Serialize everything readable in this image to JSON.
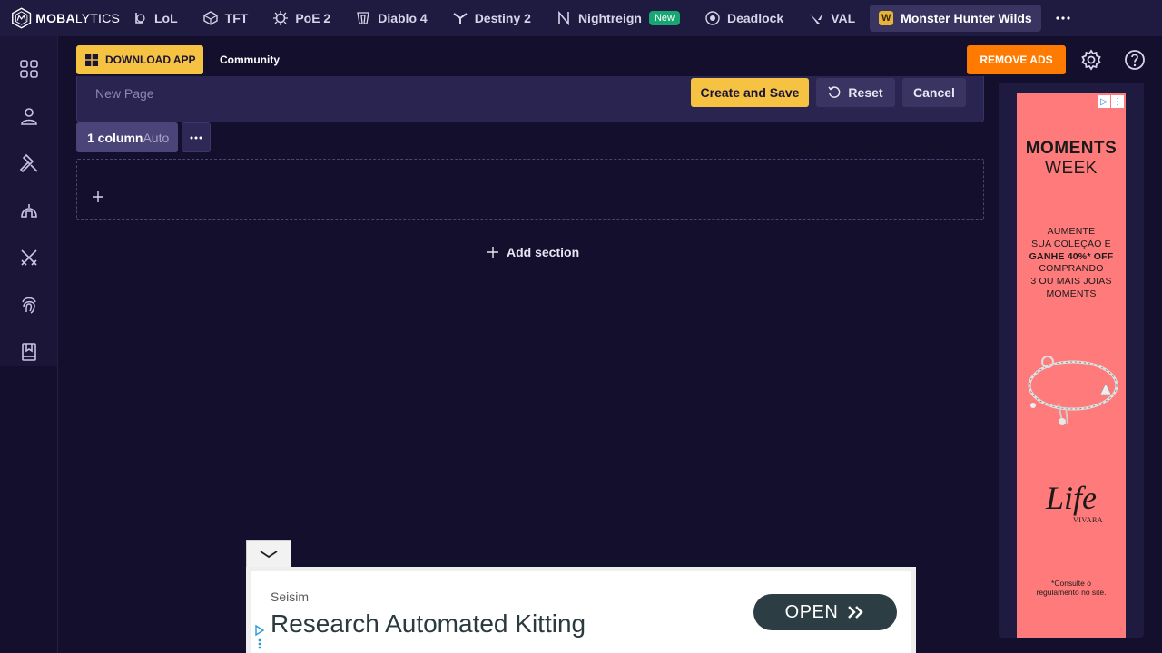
{
  "brand": {
    "bold": "MOBA",
    "light": "LYTICS"
  },
  "nav": {
    "games": [
      {
        "label": "LoL",
        "icon": "lol-icon"
      },
      {
        "label": "TFT",
        "icon": "tft-icon"
      },
      {
        "label": "PoE 2",
        "icon": "poe2-icon"
      },
      {
        "label": "Diablo 4",
        "icon": "diablo4-icon"
      },
      {
        "label": "Destiny 2",
        "icon": "destiny2-icon"
      },
      {
        "label": "Nightreign",
        "icon": "nightreign-icon",
        "badge": "New"
      },
      {
        "label": "Deadlock",
        "icon": "deadlock-icon"
      },
      {
        "label": "VAL",
        "icon": "valorant-icon"
      }
    ],
    "active": {
      "label": "Monster Hunter Wilds",
      "icon": "monster-hunter-icon"
    }
  },
  "header": {
    "download_label": "DOWNLOAD APP",
    "community_label": "Community",
    "remove_ads_label": "REMOVE ADS"
  },
  "editor": {
    "page_name_placeholder": "New Page",
    "create_label": "Create and Save",
    "reset_label": "Reset",
    "cancel_label": "Cancel",
    "column_value": "1 column",
    "column_mode": "Auto",
    "add_section_label": "Add section"
  },
  "right_ad": {
    "title1": "MOMENTS",
    "title2": "WEEK",
    "line1": "AUMENTE",
    "line2": "SUA COLEÇÃO E",
    "line3": "GANHE 40%* OFF",
    "line4": "COMPRANDO",
    "line5": "3 OU MAIS JOIAS",
    "line6": "MOMENTS",
    "brand": "Life",
    "brand_sub": "VIVARA",
    "footnote1": "*Consulte o",
    "footnote2": "regulamento no site.",
    "bg_color": "#ff7b7b"
  },
  "bottom_ad": {
    "sponsor": "Seisim",
    "headline": "Research Automated Kitting",
    "cta": "OPEN",
    "cta_color": "#2c3e44"
  },
  "colors": {
    "background": "#150f2e",
    "accent_yellow": "#f5c242",
    "accent_orange": "#ff7a00",
    "new_badge": "#18a673"
  }
}
